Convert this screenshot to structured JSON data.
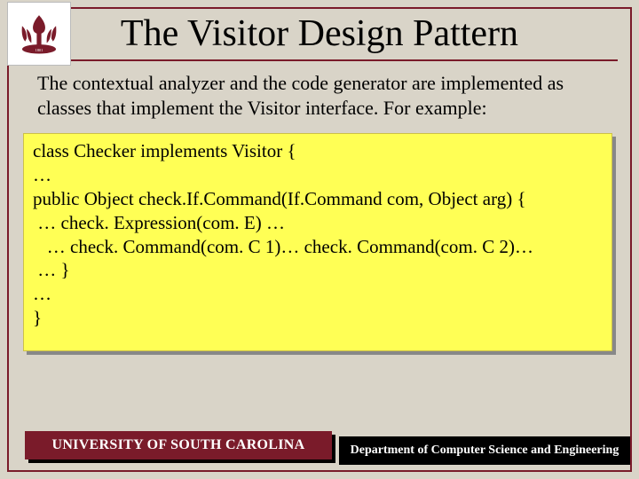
{
  "title": "The Visitor Design Pattern",
  "intro": "The contextual analyzer and the code generator are implemented as classes that implement the Visitor interface. For example:",
  "code": {
    "l1": "class Checker implements Visitor {",
    "l2": "…",
    "l3": "public Object check.If.Command(If.Command com, Object arg) {",
    "l4": " … check. Expression(com. E) …",
    "l5": "   … check. Command(com. C 1)… check. Command(com. C 2)…",
    "l6": " … }",
    "l7": "",
    "l8": "…",
    "l9": "}"
  },
  "footer": {
    "university": "UNIVERSITY OF SOUTH CAROLINA",
    "department": "Department of Computer Science and Engineering"
  }
}
